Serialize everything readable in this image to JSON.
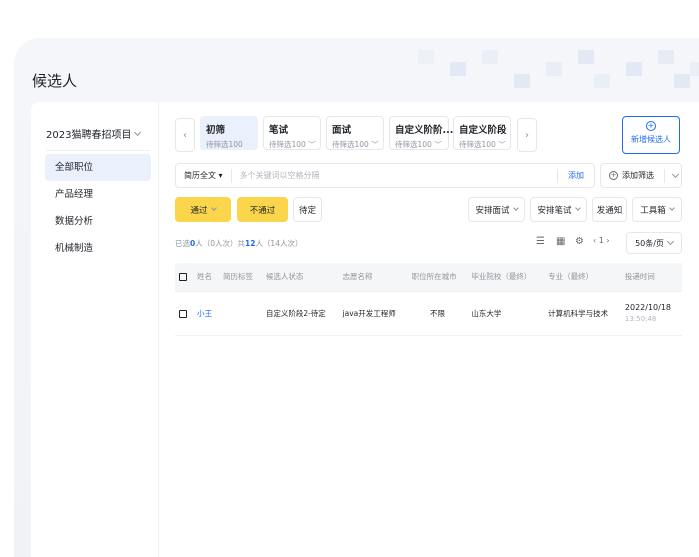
{
  "page": {
    "title": "候选人"
  },
  "sidebar": {
    "project": "2023猫聘春招项目",
    "items": [
      {
        "label": "全部职位",
        "active": true
      },
      {
        "label": "产品经理",
        "active": false
      },
      {
        "label": "数据分析",
        "active": false
      },
      {
        "label": "机械制造",
        "active": false
      }
    ]
  },
  "stages": {
    "prev": "‹",
    "next": "›",
    "tabs": [
      {
        "name": "初筛",
        "sub": "待筛选100",
        "active": true
      },
      {
        "name": "笔试",
        "sub": "待筛选100 ﹀",
        "active": false
      },
      {
        "name": "面试",
        "sub": "待筛选100 ﹀",
        "active": false
      },
      {
        "name": "自定义阶阶...",
        "sub": "待筛选100 ﹀",
        "active": false
      },
      {
        "name": "自定义阶段",
        "sub": "待筛选100 ﹀",
        "active": false
      }
    ],
    "new_candidate": {
      "icon": "+",
      "label": "新增候选人"
    }
  },
  "search": {
    "scope": "简历全文 ▾",
    "placeholder": "多个关键词以空格分隔",
    "add": "添加",
    "add_filter": "添加筛选"
  },
  "actions": {
    "pass": "通过",
    "fail": "不通过",
    "pending": "待定",
    "schedule_interview": "安排面试",
    "schedule_exam": "安排笔试",
    "notify": "发通知",
    "toolbox": "工具箱"
  },
  "selection": {
    "prefix": "已选",
    "selected": "0",
    "mid": "人（0人次）共",
    "total": "12",
    "suffix": "人（14人次）"
  },
  "pager": {
    "text": "‹ 1 ›",
    "page_size": "50条/页"
  },
  "table": {
    "headers": [
      "姓名",
      "简历标签",
      "候选人状态",
      "志愿名称",
      "职位所在城市",
      "毕业院校（最终）",
      "专业（最终）",
      "投递时间"
    ],
    "rows": [
      {
        "name": "小王",
        "tags": "",
        "status": "自定义阶段2-待定",
        "position": "java开发工程师",
        "city": "不限",
        "school": "山东大学",
        "major": "计算机科学与技术",
        "date": "2022/10/18",
        "time": "13:50:48"
      }
    ]
  }
}
